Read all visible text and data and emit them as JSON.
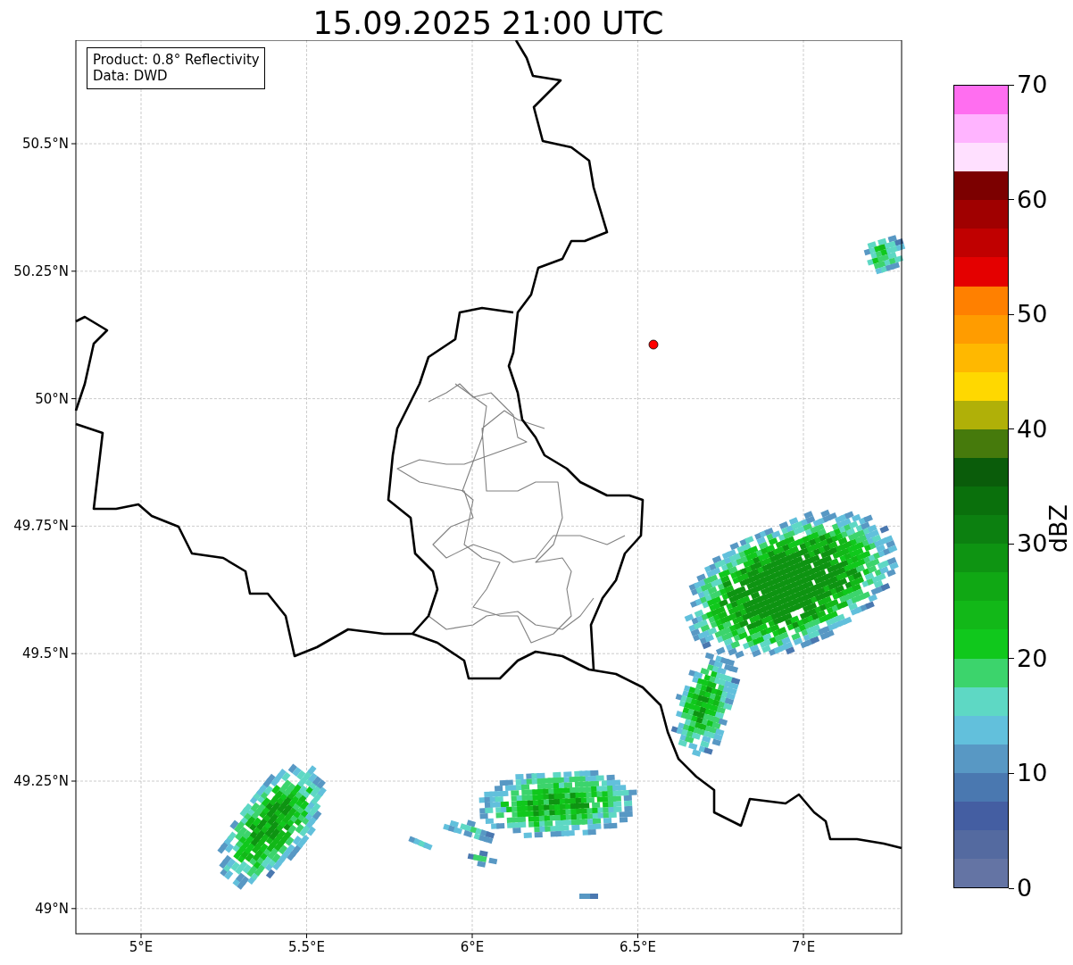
{
  "title": "15.09.2025 21:00 UTC",
  "info_box": [
    "Product: 0.8° Reflectivity",
    "Data: DWD"
  ],
  "x_ticks": [
    "5°E",
    "5.5°E",
    "6°E",
    "6.5°E",
    "7°E"
  ],
  "y_ticks": [
    "50.5°N",
    "50.25°N",
    "50°N",
    "49.75°N",
    "49.5°N",
    "49.25°N",
    "49°N"
  ],
  "colorbar": {
    "label": "dBZ",
    "ticks": [
      "70",
      "60",
      "50",
      "40",
      "30",
      "20",
      "10",
      "0"
    ],
    "bins": [
      {
        "color": "#ff6ef0"
      },
      {
        "color": "#ffb4ff"
      },
      {
        "color": "#ffe0ff"
      },
      {
        "color": "#7c0000"
      },
      {
        "color": "#a00000"
      },
      {
        "color": "#c00000"
      },
      {
        "color": "#e40000"
      },
      {
        "color": "#ff8000"
      },
      {
        "color": "#ff9c00"
      },
      {
        "color": "#ffb800"
      },
      {
        "color": "#ffd800"
      },
      {
        "color": "#b0b008"
      },
      {
        "color": "#467a0c"
      },
      {
        "color": "#0a5c0a"
      },
      {
        "color": "#0a700c"
      },
      {
        "color": "#0c8010"
      },
      {
        "color": "#0e9412"
      },
      {
        "color": "#10a814"
      },
      {
        "color": "#12b818"
      },
      {
        "color": "#10c81c"
      },
      {
        "color": "#3cd46c"
      },
      {
        "color": "#5ed8c4"
      },
      {
        "color": "#62c0dc"
      },
      {
        "color": "#5898c4"
      },
      {
        "color": "#4a78b0"
      },
      {
        "color": "#445ea2"
      },
      {
        "color": "#546aa0"
      },
      {
        "color": "#6474a4"
      }
    ]
  }
}
